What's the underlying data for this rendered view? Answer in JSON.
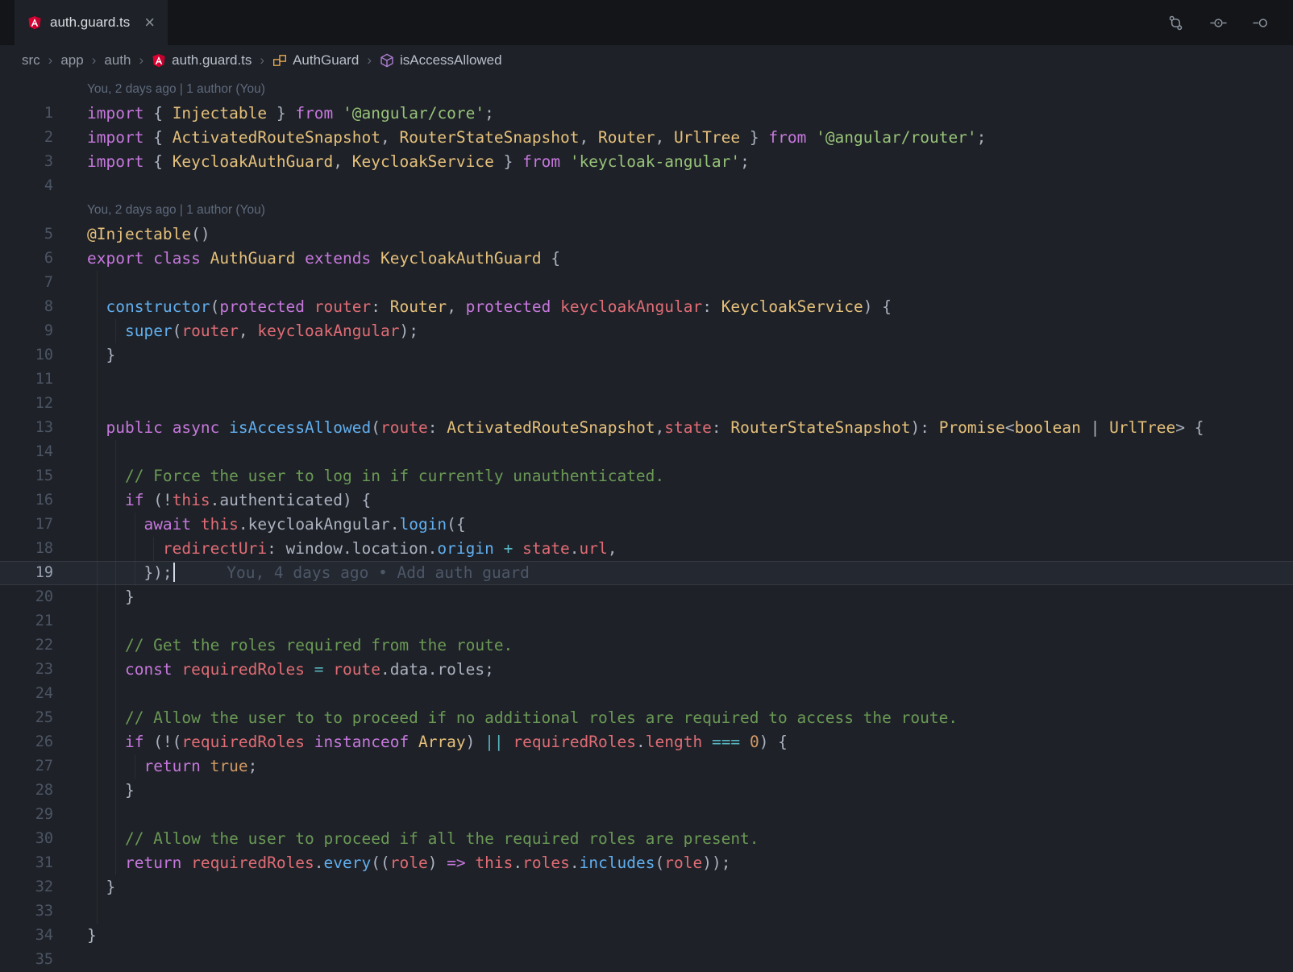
{
  "colors": {
    "bg_editor": "#1e2127",
    "bg_tabbar": "#131519",
    "foreground": "#abb2bf",
    "keyword": "#c678dd",
    "type": "#e5c07b",
    "string": "#98c379",
    "comment": "#6a9955",
    "function": "#61afef",
    "variable": "#e06c75",
    "constant": "#d19a66",
    "operator": "#56b6c2",
    "lineno": "#4c5564",
    "lineno_active": "#9aa2b2",
    "lens": "#5f6a7d",
    "blame": "#4d5768",
    "tab_label": "#d8dbe0",
    "icon": "#8b929c",
    "breadcrumb_text": "#949aa6",
    "breadcrumb_file": "#b9bfc9",
    "separator": "#5d6571",
    "angular_red": "#dd0031",
    "class_icon_color": "#e8ab53",
    "method_icon_color": "#b180d7"
  },
  "tab": {
    "label": "auth.guard.ts",
    "close_glyph": "×"
  },
  "header_icons": [
    {
      "name": "git-compare-icon"
    },
    {
      "name": "open-changes-icon"
    },
    {
      "name": "toggle-inline-blame-icon"
    }
  ],
  "breadcrumb": {
    "separator": "›",
    "items": [
      {
        "label": "src"
      },
      {
        "label": "app"
      },
      {
        "label": "auth"
      },
      {
        "label": "auth.guard.ts",
        "icon": "angular-icon"
      },
      {
        "label": "AuthGuard",
        "icon": "class-icon"
      },
      {
        "label": "isAccessAllowed",
        "icon": "method-icon"
      }
    ]
  },
  "editor": {
    "rows": [
      {
        "type": "lens",
        "num": "",
        "ind": 0,
        "text": "You, 2 days ago | 1 author (You)"
      },
      {
        "type": "code",
        "num": "1",
        "ind": 0,
        "tokens": [
          [
            "k",
            "import"
          ],
          [
            "d",
            " { "
          ],
          [
            "t",
            "Injectable"
          ],
          [
            "d",
            " } "
          ],
          [
            "k",
            "from"
          ],
          [
            "d",
            " "
          ],
          [
            "s",
            "'@angular/core'"
          ],
          [
            "d",
            ";"
          ]
        ]
      },
      {
        "type": "code",
        "num": "2",
        "ind": 0,
        "tokens": [
          [
            "k",
            "import"
          ],
          [
            "d",
            " { "
          ],
          [
            "t",
            "ActivatedRouteSnapshot"
          ],
          [
            "d",
            ", "
          ],
          [
            "t",
            "RouterStateSnapshot"
          ],
          [
            "d",
            ", "
          ],
          [
            "t",
            "Router"
          ],
          [
            "d",
            ", "
          ],
          [
            "t",
            "UrlTree"
          ],
          [
            "d",
            " } "
          ],
          [
            "k",
            "from"
          ],
          [
            "d",
            " "
          ],
          [
            "s",
            "'@angular/router'"
          ],
          [
            "d",
            ";"
          ]
        ]
      },
      {
        "type": "code",
        "num": "3",
        "ind": 0,
        "tokens": [
          [
            "k",
            "import"
          ],
          [
            "d",
            " { "
          ],
          [
            "t",
            "KeycloakAuthGuard"
          ],
          [
            "d",
            ", "
          ],
          [
            "t",
            "KeycloakService"
          ],
          [
            "d",
            " } "
          ],
          [
            "k",
            "from"
          ],
          [
            "d",
            " "
          ],
          [
            "s",
            "'keycloak-angular'"
          ],
          [
            "d",
            ";"
          ]
        ]
      },
      {
        "type": "code",
        "num": "4",
        "ind": 0,
        "tokens": []
      },
      {
        "type": "lens",
        "num": "",
        "ind": 0,
        "text": "You, 2 days ago | 1 author (You)"
      },
      {
        "type": "code",
        "num": "5",
        "ind": 0,
        "tokens": [
          [
            "t",
            "@Injectable"
          ],
          [
            "d",
            "()"
          ]
        ]
      },
      {
        "type": "code",
        "num": "6",
        "ind": 0,
        "tokens": [
          [
            "k",
            "export"
          ],
          [
            "d",
            " "
          ],
          [
            "k",
            "class"
          ],
          [
            "d",
            " "
          ],
          [
            "t",
            "AuthGuard"
          ],
          [
            "d",
            " "
          ],
          [
            "k",
            "extends"
          ],
          [
            "d",
            " "
          ],
          [
            "t",
            "KeycloakAuthGuard"
          ],
          [
            "d",
            " {"
          ]
        ]
      },
      {
        "type": "code",
        "num": "7",
        "ind": 1,
        "tokens": []
      },
      {
        "type": "code",
        "num": "8",
        "ind": 1,
        "tokens": [
          [
            "d",
            "  "
          ],
          [
            "f",
            "constructor"
          ],
          [
            "d",
            "("
          ],
          [
            "k",
            "protected"
          ],
          [
            "d",
            " "
          ],
          [
            "v",
            "router"
          ],
          [
            "d",
            ": "
          ],
          [
            "t",
            "Router"
          ],
          [
            "d",
            ", "
          ],
          [
            "k",
            "protected"
          ],
          [
            "d",
            " "
          ],
          [
            "v",
            "keycloakAngular"
          ],
          [
            "d",
            ": "
          ],
          [
            "t",
            "KeycloakService"
          ],
          [
            "d",
            ") {"
          ]
        ]
      },
      {
        "type": "code",
        "num": "9",
        "ind": 2,
        "tokens": [
          [
            "d",
            "    "
          ],
          [
            "f",
            "super"
          ],
          [
            "d",
            "("
          ],
          [
            "v",
            "router"
          ],
          [
            "d",
            ", "
          ],
          [
            "v",
            "keycloakAngular"
          ],
          [
            "d",
            ");"
          ]
        ]
      },
      {
        "type": "code",
        "num": "10",
        "ind": 1,
        "tokens": [
          [
            "d",
            "  }"
          ]
        ]
      },
      {
        "type": "code",
        "num": "11",
        "ind": 1,
        "tokens": []
      },
      {
        "type": "code",
        "num": "12",
        "ind": 1,
        "tokens": []
      },
      {
        "type": "code",
        "num": "13",
        "ind": 1,
        "tokens": [
          [
            "d",
            "  "
          ],
          [
            "k",
            "public"
          ],
          [
            "d",
            " "
          ],
          [
            "k",
            "async"
          ],
          [
            "d",
            " "
          ],
          [
            "f",
            "isAccessAllowed"
          ],
          [
            "d",
            "("
          ],
          [
            "v",
            "route"
          ],
          [
            "d",
            ": "
          ],
          [
            "t",
            "ActivatedRouteSnapshot"
          ],
          [
            "d",
            ","
          ],
          [
            "v",
            "state"
          ],
          [
            "d",
            ": "
          ],
          [
            "t",
            "RouterStateSnapshot"
          ],
          [
            "d",
            "): "
          ],
          [
            "t",
            "Promise"
          ],
          [
            "d",
            "<"
          ],
          [
            "t",
            "boolean"
          ],
          [
            "d",
            " | "
          ],
          [
            "t",
            "UrlTree"
          ],
          [
            "d",
            "> {"
          ]
        ]
      },
      {
        "type": "code",
        "num": "14",
        "ind": 2,
        "tokens": []
      },
      {
        "type": "code",
        "num": "15",
        "ind": 2,
        "tokens": [
          [
            "c",
            "    // Force the user to log in if currently unauthenticated."
          ]
        ]
      },
      {
        "type": "code",
        "num": "16",
        "ind": 2,
        "tokens": [
          [
            "d",
            "    "
          ],
          [
            "k",
            "if"
          ],
          [
            "d",
            " (!"
          ],
          [
            "v",
            "this"
          ],
          [
            "d",
            ".authenticated) {"
          ]
        ]
      },
      {
        "type": "code",
        "num": "17",
        "ind": 3,
        "tokens": [
          [
            "d",
            "      "
          ],
          [
            "k",
            "await"
          ],
          [
            "d",
            " "
          ],
          [
            "v",
            "this"
          ],
          [
            "d",
            ".keycloakAngular."
          ],
          [
            "f",
            "login"
          ],
          [
            "d",
            "({"
          ]
        ]
      },
      {
        "type": "code",
        "num": "18",
        "ind": 4,
        "tokens": [
          [
            "d",
            "        "
          ],
          [
            "v",
            "redirectUri"
          ],
          [
            "d",
            ": window.location."
          ],
          [
            "f",
            "origin"
          ],
          [
            "d",
            " "
          ],
          [
            "o",
            "+"
          ],
          [
            "d",
            " "
          ],
          [
            "v",
            "state"
          ],
          [
            "d",
            "."
          ],
          [
            "v",
            "url"
          ],
          [
            "d",
            ","
          ]
        ]
      },
      {
        "type": "code",
        "num": "19",
        "ind": 3,
        "current": true,
        "cursor": true,
        "blame": "You, 4 days ago • Add auth guard",
        "tokens": [
          [
            "d",
            "      });"
          ]
        ]
      },
      {
        "type": "code",
        "num": "20",
        "ind": 2,
        "tokens": [
          [
            "d",
            "    }"
          ]
        ]
      },
      {
        "type": "code",
        "num": "21",
        "ind": 2,
        "tokens": []
      },
      {
        "type": "code",
        "num": "22",
        "ind": 2,
        "tokens": [
          [
            "c",
            "    // Get the roles required from the route."
          ]
        ]
      },
      {
        "type": "code",
        "num": "23",
        "ind": 2,
        "tokens": [
          [
            "d",
            "    "
          ],
          [
            "k",
            "const"
          ],
          [
            "d",
            " "
          ],
          [
            "v",
            "requiredRoles"
          ],
          [
            "d",
            " "
          ],
          [
            "o",
            "="
          ],
          [
            "d",
            " "
          ],
          [
            "v",
            "route"
          ],
          [
            "d",
            ".data.roles;"
          ]
        ]
      },
      {
        "type": "code",
        "num": "24",
        "ind": 2,
        "tokens": []
      },
      {
        "type": "code",
        "num": "25",
        "ind": 2,
        "tokens": [
          [
            "c",
            "    // Allow the user to to proceed if no additional roles are required to access the route."
          ]
        ]
      },
      {
        "type": "code",
        "num": "26",
        "ind": 2,
        "tokens": [
          [
            "d",
            "    "
          ],
          [
            "k",
            "if"
          ],
          [
            "d",
            " (!("
          ],
          [
            "v",
            "requiredRoles"
          ],
          [
            "d",
            " "
          ],
          [
            "k",
            "instanceof"
          ],
          [
            "d",
            " "
          ],
          [
            "t",
            "Array"
          ],
          [
            "d",
            ") "
          ],
          [
            "o",
            "||"
          ],
          [
            "d",
            " "
          ],
          [
            "v",
            "requiredRoles"
          ],
          [
            "d",
            "."
          ],
          [
            "v",
            "length"
          ],
          [
            "d",
            " "
          ],
          [
            "o",
            "==="
          ],
          [
            "d",
            " "
          ],
          [
            "n",
            "0"
          ],
          [
            "d",
            ") {"
          ]
        ]
      },
      {
        "type": "code",
        "num": "27",
        "ind": 3,
        "tokens": [
          [
            "d",
            "      "
          ],
          [
            "k",
            "return"
          ],
          [
            "d",
            " "
          ],
          [
            "n",
            "true"
          ],
          [
            "d",
            ";"
          ]
        ]
      },
      {
        "type": "code",
        "num": "28",
        "ind": 2,
        "tokens": [
          [
            "d",
            "    }"
          ]
        ]
      },
      {
        "type": "code",
        "num": "29",
        "ind": 2,
        "tokens": []
      },
      {
        "type": "code",
        "num": "30",
        "ind": 2,
        "tokens": [
          [
            "c",
            "    // Allow the user to proceed if all the required roles are present."
          ]
        ]
      },
      {
        "type": "code",
        "num": "31",
        "ind": 2,
        "tokens": [
          [
            "d",
            "    "
          ],
          [
            "k",
            "return"
          ],
          [
            "d",
            " "
          ],
          [
            "v",
            "requiredRoles"
          ],
          [
            "d",
            "."
          ],
          [
            "f",
            "every"
          ],
          [
            "d",
            "(("
          ],
          [
            "v",
            "role"
          ],
          [
            "d",
            ") "
          ],
          [
            "k",
            "=>"
          ],
          [
            "d",
            " "
          ],
          [
            "v",
            "this"
          ],
          [
            "d",
            "."
          ],
          [
            "v",
            "roles"
          ],
          [
            "d",
            "."
          ],
          [
            "f",
            "includes"
          ],
          [
            "d",
            "("
          ],
          [
            "v",
            "role"
          ],
          [
            "d",
            "));"
          ]
        ]
      },
      {
        "type": "code",
        "num": "32",
        "ind": 1,
        "tokens": [
          [
            "d",
            "  }"
          ]
        ]
      },
      {
        "type": "code",
        "num": "33",
        "ind": 1,
        "tokens": []
      },
      {
        "type": "code",
        "num": "34",
        "ind": 0,
        "tokens": [
          [
            "d",
            "}"
          ]
        ]
      },
      {
        "type": "code",
        "num": "35",
        "ind": 0,
        "tokens": []
      }
    ]
  }
}
